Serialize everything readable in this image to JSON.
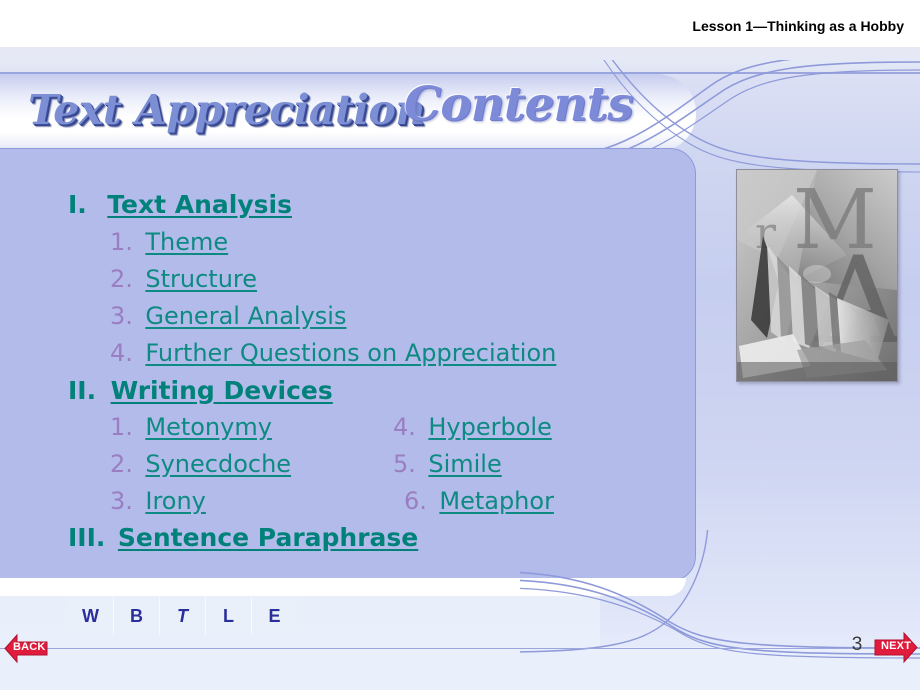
{
  "header": {
    "lesson": "Lesson 1—Thinking as a Hobby"
  },
  "banner": {
    "title": "Text Appreciation",
    "subtitle": "Contents"
  },
  "contents": {
    "sections": [
      {
        "numeral": "I.",
        "label": "Text Analysis ",
        "items": [
          {
            "num": "1.",
            "label": "Theme"
          },
          {
            "num": "2.",
            "label": "Structure"
          },
          {
            "num": "3.",
            "label": "General Analysis"
          },
          {
            "num": "4.",
            "label": "Further Questions on Appreciation"
          }
        ]
      },
      {
        "numeral": "II.",
        "label": "Writing Devices",
        "items": [
          {
            "num": "1.",
            "label": "Metonymy"
          },
          {
            "num": "2.",
            "label": "Synecdoche"
          },
          {
            "num": "3.",
            "label": "Irony"
          },
          {
            "num": "4.",
            "label": "Hyperbole"
          },
          {
            "num": "5.",
            "label": "Simile"
          },
          {
            "num": "6.",
            "label": "Metaphor"
          }
        ]
      },
      {
        "numeral": "III.",
        "label": "Sentence Paraphrase",
        "items": []
      }
    ]
  },
  "thumbnail": {
    "alt_letters": [
      "r",
      "M",
      "A"
    ],
    "description": "grayscale open books collage with serif letters"
  },
  "navbar": {
    "buttons": [
      {
        "label": "W",
        "name": "nav-button-w",
        "italic": false
      },
      {
        "label": "B",
        "name": "nav-button-b",
        "italic": false
      },
      {
        "label": "T",
        "name": "nav-button-t",
        "italic": true
      },
      {
        "label": "L",
        "name": "nav-button-l",
        "italic": false
      },
      {
        "label": "E",
        "name": "nav-button-e",
        "italic": false
      }
    ]
  },
  "footer": {
    "page_number": "3",
    "back_label": "BACK",
    "next_label": "NEXT"
  },
  "colors": {
    "panel": "#b3bbeb",
    "teal": "#00827b",
    "mauve": "#9a7ec1",
    "periwinkle": "#7d8ad8",
    "navy": "#2b2f9c",
    "arrow_red": "#e01b3c"
  }
}
